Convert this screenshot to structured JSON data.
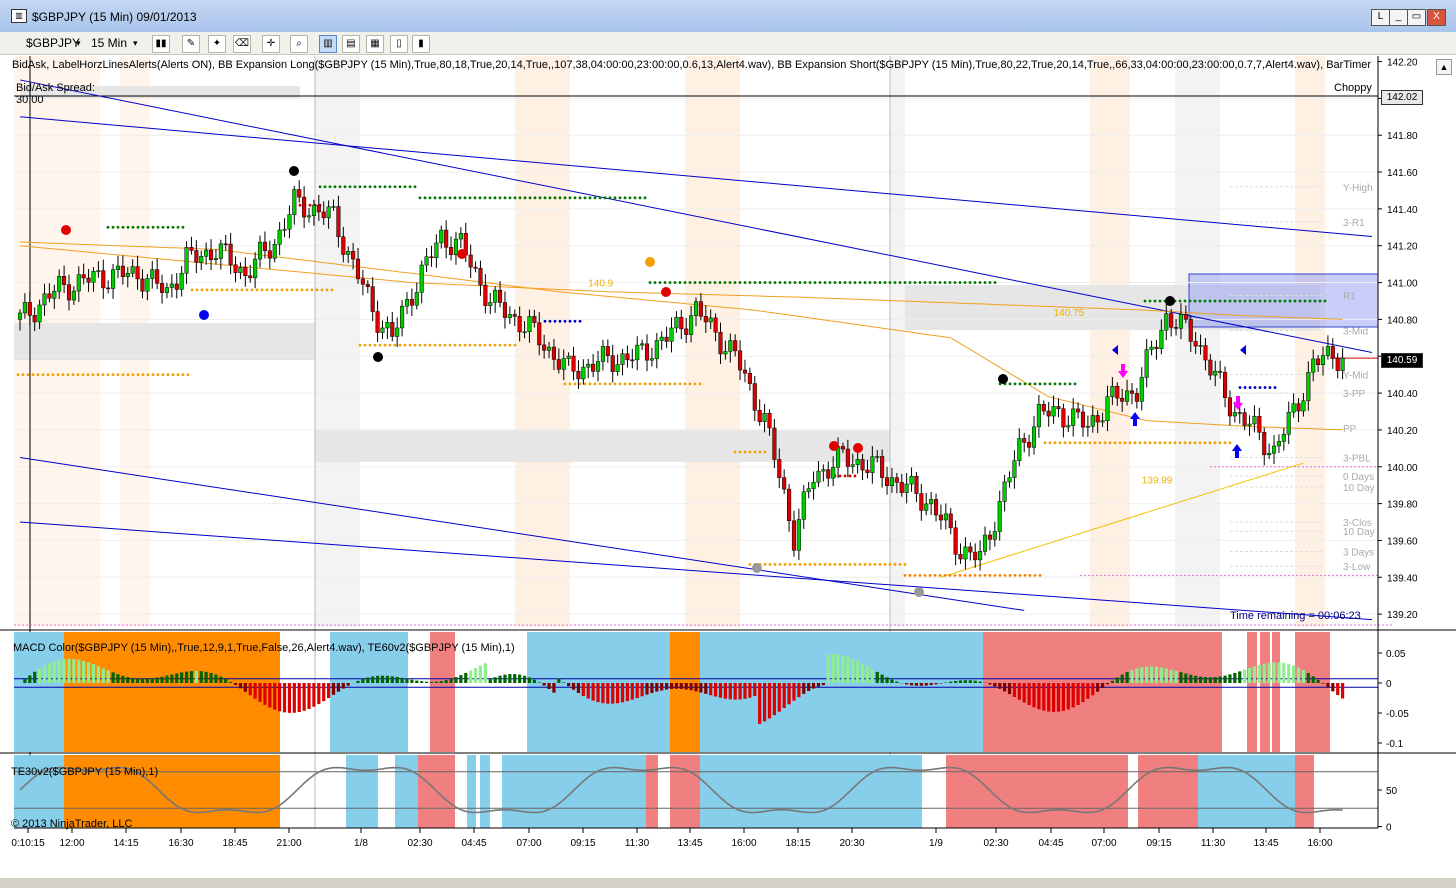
{
  "window": {
    "title": "$GBPJPY (15 Min)  09/01/2013",
    "buttons": [
      "L",
      "_",
      "▭",
      "X"
    ]
  },
  "toolbar": {
    "instrument": "$GBPJPY",
    "interval": "15 Min"
  },
  "chart": {
    "indicators_line": "BidAsk, LabelHorzLinesAlerts(Alerts ON), BB Expansion Long($GBPJPY (15 Min),True,80,18,True,20,14,True,,107,38,04:00:00,23:00:00,0.6,13,Alert4.wav), BB Expansion Short($GBPJPY (15 Min),True,80,22,True,20,14,True,,66,33,04:00:00,23:00:00,0.7,7,Alert4.wav), BarTimer",
    "bidask_label": "Bid/Ask Spread:",
    "bidask_value": "30.00",
    "choppy_label": "Choppy",
    "time_remaining": "Time remaining = 00:06:23",
    "copyright": "© 2013 NinjaTrader, LLC",
    "macd_label": "MACD Color($GBPJPY (15 Min),,True,12,9,1,True,False,26,Alert4.wav), TE60v2($GBPJPY (15 Min),1)",
    "te30_label": "TE30v2($GBPJPY (15 Min),1)",
    "ask_tag": "142.02",
    "last_tag": "140.59",
    "level_labels": [
      {
        "text": "Y-High",
        "price": 141.52
      },
      {
        "text": "3-R1",
        "price": 141.33
      },
      {
        "text": "R1",
        "price": 140.93
      },
      {
        "text": "3-Mid",
        "price": 140.74
      },
      {
        "text": "Y-Mid",
        "price": 140.5
      },
      {
        "text": "3-PP",
        "price": 140.4
      },
      {
        "text": "PP",
        "price": 140.21
      },
      {
        "text": "3-PBL",
        "price": 140.05
      },
      {
        "text": "0 Days",
        "price": 139.95
      },
      {
        "text": "10 Day",
        "price": 139.89
      },
      {
        "text": "3-Clos",
        "price": 139.7
      },
      {
        "text": "10 Day",
        "price": 139.65
      },
      {
        "text": "3 Days",
        "price": 139.54
      },
      {
        "text": "3-Low",
        "price": 139.46
      }
    ],
    "marker_labels": [
      {
        "text": "140.75",
        "price": 140.84,
        "bar": 211
      },
      {
        "text": "139.99",
        "price": 139.93,
        "bar": 229
      },
      {
        "text": "140.9",
        "price": 141.0,
        "bar": 116
      }
    ]
  },
  "chart_data": {
    "type": "candlestick",
    "instrument": "$GBPJPY",
    "interval": "15 Min",
    "date": "09/01/2013",
    "price_axis": {
      "ticks": [
        142.2,
        142.0,
        141.8,
        141.6,
        141.4,
        141.2,
        141.0,
        140.8,
        140.6,
        140.4,
        140.2,
        140.0,
        139.8,
        139.6,
        139.4,
        139.2
      ],
      "range": [
        139.13,
        142.23
      ]
    },
    "time_axis": {
      "ticks": [
        "0:10:15",
        "12:00",
        "14:15",
        "16:30",
        "18:45",
        "21:00",
        "1/8",
        "02:30",
        "04:45",
        "07:00",
        "09:15",
        "11:30",
        "13:45",
        "16:00",
        "18:15",
        "20:30",
        "1/9",
        "02:30",
        "04:45",
        "07:00",
        "09:15",
        "11:30",
        "13:45",
        "16:00"
      ]
    },
    "close_path": [
      [
        0,
        140.8
      ],
      [
        8,
        140.97
      ],
      [
        16,
        141.03
      ],
      [
        24,
        141.05
      ],
      [
        30,
        140.95
      ],
      [
        34,
        141.12
      ],
      [
        40,
        141.18
      ],
      [
        46,
        141.05
      ],
      [
        52,
        141.22
      ],
      [
        56,
        141.43
      ],
      [
        60,
        141.4
      ],
      [
        64,
        141.35
      ],
      [
        68,
        141.1
      ],
      [
        72,
        140.85
      ],
      [
        76,
        140.7
      ],
      [
        80,
        140.95
      ],
      [
        86,
        141.25
      ],
      [
        90,
        141.2
      ],
      [
        96,
        140.9
      ],
      [
        104,
        140.75
      ],
      [
        112,
        140.52
      ],
      [
        120,
        140.58
      ],
      [
        126,
        140.6
      ],
      [
        132,
        140.7
      ],
      [
        138,
        140.85
      ],
      [
        146,
        140.6
      ],
      [
        152,
        140.25
      ],
      [
        156,
        139.85
      ],
      [
        158,
        139.62
      ],
      [
        162,
        139.95
      ],
      [
        168,
        140.05
      ],
      [
        174,
        140.0
      ],
      [
        180,
        139.9
      ],
      [
        186,
        139.8
      ],
      [
        192,
        139.55
      ],
      [
        196,
        139.5
      ],
      [
        200,
        139.8
      ],
      [
        204,
        140.1
      ],
      [
        208,
        140.28
      ],
      [
        212,
        140.3
      ],
      [
        218,
        140.22
      ],
      [
        222,
        140.35
      ],
      [
        228,
        140.42
      ],
      [
        234,
        140.82
      ],
      [
        240,
        140.7
      ],
      [
        244,
        140.48
      ],
      [
        248,
        140.3
      ],
      [
        252,
        140.2
      ],
      [
        256,
        140.08
      ],
      [
        260,
        140.3
      ],
      [
        264,
        140.55
      ],
      [
        268,
        140.62
      ],
      [
        270,
        140.59
      ]
    ],
    "moving_averages": [
      {
        "color": "#f0a020",
        "path": [
          [
            0,
            141.2
          ],
          [
            40,
            141.1
          ],
          [
            80,
            141.0
          ],
          [
            120,
            140.95
          ],
          [
            160,
            140.92
          ],
          [
            200,
            140.88
          ],
          [
            230,
            140.85
          ],
          [
            250,
            140.82
          ],
          [
            270,
            140.8
          ]
        ]
      },
      {
        "color": "#f0a020",
        "path": [
          [
            0,
            141.22
          ],
          [
            40,
            141.18
          ],
          [
            80,
            141.05
          ],
          [
            110,
            140.95
          ],
          [
            150,
            140.85
          ],
          [
            190,
            140.7
          ],
          [
            210,
            140.38
          ],
          [
            230,
            140.25
          ],
          [
            250,
            140.22
          ],
          [
            270,
            140.2
          ]
        ]
      }
    ],
    "trendlines": [
      {
        "color": "#0000cc",
        "from": [
          0,
          142.1
        ],
        "to": [
          276,
          140.62
        ]
      },
      {
        "color": "#0000cc",
        "from": [
          0,
          141.9
        ],
        "to": [
          276,
          141.25
        ]
      },
      {
        "color": "#0000cc",
        "from": [
          0,
          140.05
        ],
        "to": [
          205,
          139.22
        ]
      },
      {
        "color": "#0000cc",
        "from": [
          0,
          139.7
        ],
        "to": [
          276,
          139.17
        ]
      },
      {
        "color": "#f5c000",
        "from": [
          188,
          139.4
        ],
        "to": [
          262,
          140.02
        ]
      }
    ],
    "macd_axis": {
      "ticks": [
        0.05,
        0,
        -0.05,
        -0.1
      ],
      "range": [
        -0.115,
        0.085
      ]
    },
    "te30_axis": {
      "ticks": [
        50,
        0
      ],
      "range": [
        -2,
        98
      ]
    }
  }
}
